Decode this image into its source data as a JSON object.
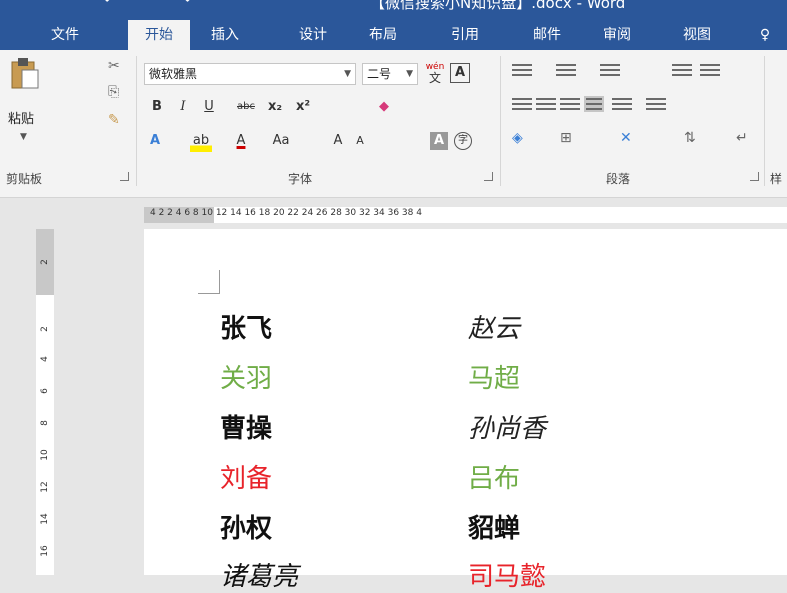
{
  "window": {
    "title": "【微信搜索小N知识盘】.docx - Word"
  },
  "tabs": [
    {
      "label": "文件"
    },
    {
      "label": "开始",
      "active": true
    },
    {
      "label": "插入"
    },
    {
      "label": "设计"
    },
    {
      "label": "布局"
    },
    {
      "label": "引用"
    },
    {
      "label": "邮件"
    },
    {
      "label": "审阅"
    },
    {
      "label": "视图"
    },
    {
      "label": "♀"
    }
  ],
  "ribbon": {
    "clipboard": {
      "paste_label": "粘贴",
      "group_label": "剪贴板"
    },
    "font": {
      "font_name": "微软雅黑",
      "font_size": "二号",
      "phonetic_label": "wén",
      "phonetic_char": "文",
      "border_char": "A",
      "bold": "B",
      "italic": "I",
      "underline": "U",
      "strike": "abc",
      "subscript": "x₂",
      "superscript": "x²",
      "text_effect": "A",
      "highlight": "ab",
      "font_color": "A",
      "change_case": "Aa",
      "grow": "A",
      "shrink": "A",
      "shading_char": "A",
      "enclose_char": "字",
      "group_label": "字体"
    },
    "paragraph": {
      "group_label": "段落"
    },
    "styles": {
      "group_label": "样"
    }
  },
  "ruler": {
    "corner": "L",
    "h_numbers": "4  2        2   4   6   8  10  12  14  16  18  20  22  24  26  28  30  32  34  36  38  4",
    "v_numbers": [
      "2",
      "2",
      "4",
      "6",
      "8",
      "10",
      "12",
      "14",
      "16"
    ]
  },
  "document": {
    "rows": [
      {
        "left": "张飞",
        "right": "赵云"
      },
      {
        "left": "关羽",
        "right": "马超"
      },
      {
        "left": "曹操",
        "right": "孙尚香"
      },
      {
        "left": "刘备",
        "right": "吕布"
      },
      {
        "left": "孙权",
        "right": "貂蝉"
      },
      {
        "left": "诸葛亮",
        "right": "司马懿"
      }
    ]
  },
  "colors": {
    "brand": "#2b579a",
    "green": "#70ad47",
    "red": "#e8232a"
  }
}
